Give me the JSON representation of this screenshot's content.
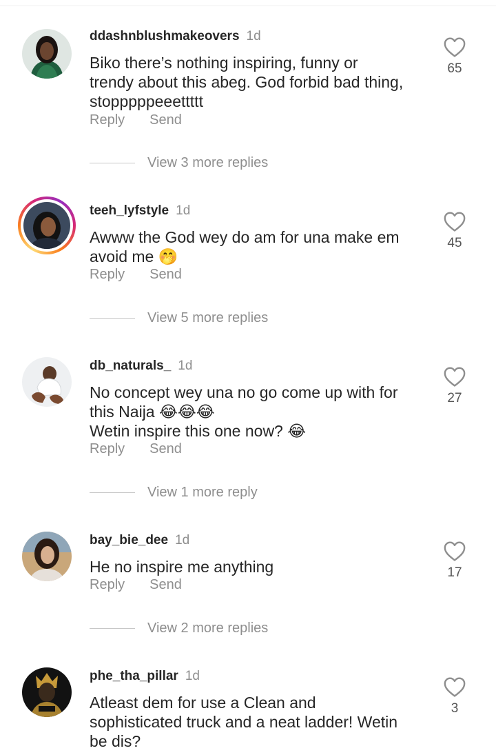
{
  "comments": [
    {
      "username": "ddashnblushmakeovers",
      "time": "1d",
      "text": "Biko there’s nothing inspiring, funny or\ntrendy about this abeg. God forbid bad thing,\nstopppppeeettttt",
      "likes": "65",
      "reply_label": "Reply",
      "send_label": "Send",
      "view_replies": "View 3 more replies"
    },
    {
      "username": "teeh_lyfstyle",
      "time": "1d",
      "text": "Awww the God wey do am for una make em\navoid me 🤭",
      "likes": "45",
      "reply_label": "Reply",
      "send_label": "Send",
      "view_replies": "View 5 more replies"
    },
    {
      "username": "db_naturals_",
      "time": "1d",
      "text": "No concept wey una no go come up with for\nthis Naija 😂😂😂\nWetin inspire this one now? 😂",
      "likes": "27",
      "reply_label": "Reply",
      "send_label": "Send",
      "view_replies": "View 1 more reply"
    },
    {
      "username": "bay_bie_dee",
      "time": "1d",
      "text": "He no inspire me anything",
      "likes": "17",
      "reply_label": "Reply",
      "send_label": "Send",
      "view_replies": "View 2 more replies"
    },
    {
      "username": "phe_tha_pillar",
      "time": "1d",
      "text": "Atleast dem for use a Clean and\nsophisticated truck and a neat ladder! Wetin\nbe dis?",
      "likes": "3"
    }
  ],
  "icons": {
    "like": "heart-outline-icon"
  },
  "colors": {
    "username": "#262626",
    "secondary_text": "#8e8e8e",
    "story_ring": "#d62976"
  }
}
